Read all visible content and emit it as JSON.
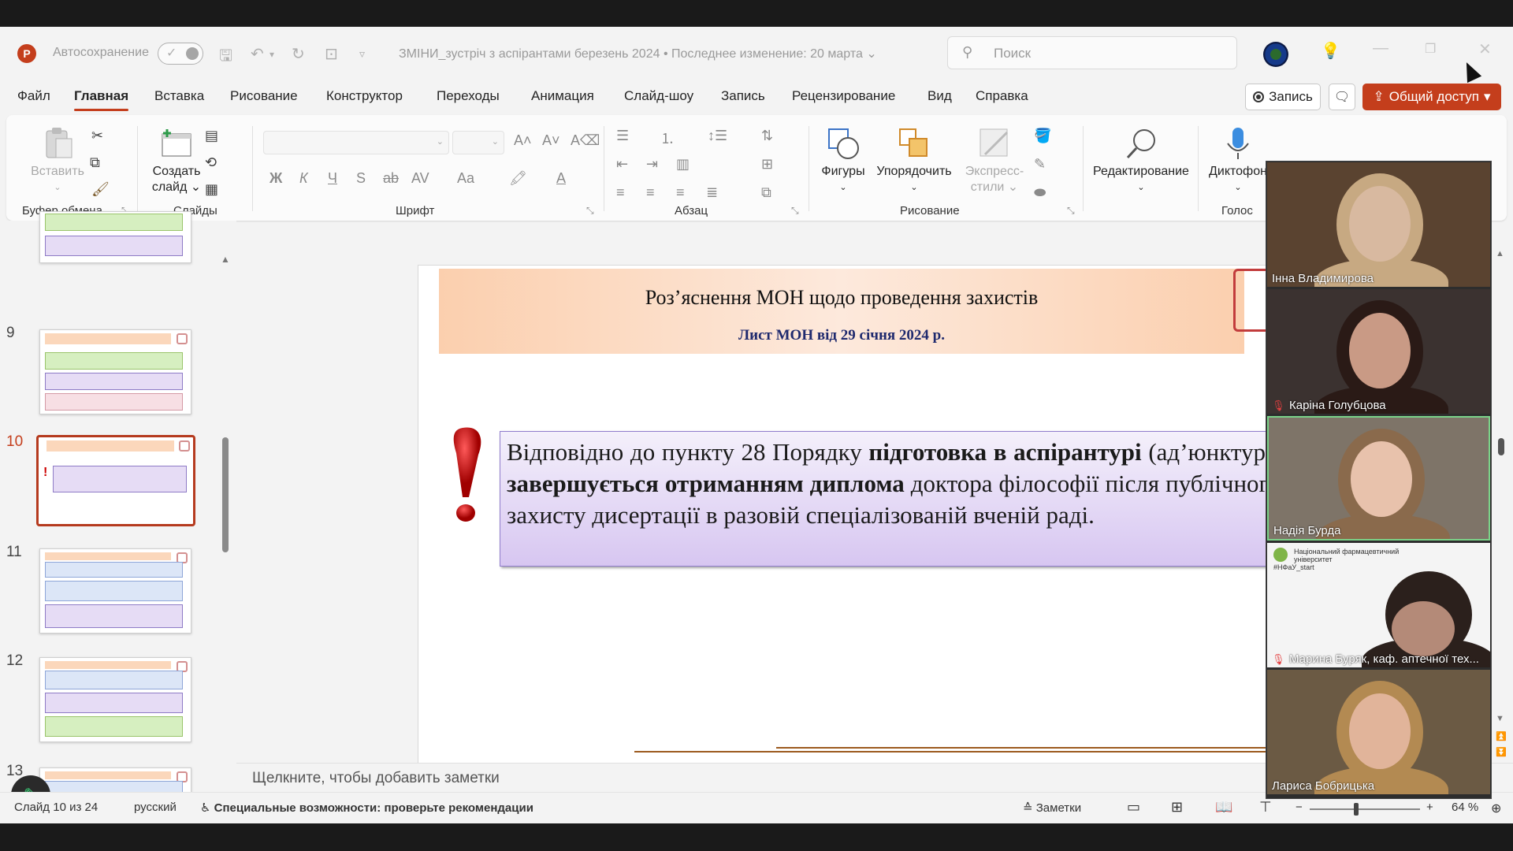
{
  "app": {
    "logo_letter": "P",
    "autosave_label": "Автосохранение",
    "doc_title": "ЗМІНИ_зустріч з аспірантами березень 2024",
    "last_modified": "Последнее изменение: 20 марта",
    "search_placeholder": "Поиск",
    "accent_color": "#c43e1c"
  },
  "menu": {
    "items": [
      "Файл",
      "Главная",
      "Вставка",
      "Рисование",
      "Конструктор",
      "Переходы",
      "Анимация",
      "Слайд-шоу",
      "Запись",
      "Рецензирование",
      "Вид",
      "Справка"
    ],
    "active": "Главная",
    "record_label": "Запись",
    "share_label": "Общий доступ"
  },
  "ribbon": {
    "paste_label": "Вставить",
    "new_slide_label_1": "Создать",
    "new_slide_label_2": "слайд",
    "shapes_label": "Фигуры",
    "arrange_label": "Упорядочить",
    "quick_styles_label_1": "Экспресс-",
    "quick_styles_label_2": "стили",
    "editing_label": "Редактирование",
    "dictate_label": "Диктофон",
    "groups": {
      "clipboard": "Буфер обмена",
      "slides": "Слайды",
      "font": "Шрифт",
      "paragraph": "Абзац",
      "drawing": "Рисование",
      "voice": "Голос"
    },
    "font_buttons": {
      "bold": "Ж",
      "italic": "К",
      "underline": "Ч",
      "shadow": "S",
      "strike": "ab",
      "spacing": "AV",
      "case": "Aa",
      "color": "A"
    }
  },
  "thumbnails": [
    {
      "number": "9"
    },
    {
      "number": "10",
      "active": true
    },
    {
      "number": "11"
    },
    {
      "number": "12"
    },
    {
      "number": "13"
    }
  ],
  "slide": {
    "title": "Роз’яснення МОН щодо проведення захистів",
    "subtitle": "Лист МОН від 29 січня 2024 р.",
    "body_parts": [
      {
        "text": "Відповідно до пункту 28 Порядку ",
        "bold": false
      },
      {
        "text": "підготовка в аспірантурі",
        "bold": true
      },
      {
        "text": " (ад’юнктурі) ",
        "bold": false
      },
      {
        "text": "завершується отриманням диплома",
        "bold": true
      },
      {
        "text": " доктора філософії після публічного захисту дисертації в разовій спеціалізованій вченій раді.",
        "bold": false
      }
    ]
  },
  "notes_placeholder": "Щелкните, чтобы добавить заметки",
  "status": {
    "slide_counter": "Слайд 10 из 24",
    "language": "русский",
    "accessibility": "Специальные возможности: проверьте рекомендации",
    "notes_label": "Заметки",
    "zoom": "64 %",
    "zoom_fraction": 0.42
  },
  "participants": [
    {
      "name": "Інна Владимирова",
      "muted": false,
      "bg": "#5a4330",
      "face": "#d8b9a0",
      "hair": "#c7a982"
    },
    {
      "name": "Каріна Голубцова",
      "muted": true,
      "bg": "#3b3230",
      "face": "#c99a85",
      "hair": "#2a1a16"
    },
    {
      "name": "Надія Бурда",
      "muted": false,
      "bg": "#7e7468",
      "face": "#e8c2ac",
      "hair": "#8a6a4c"
    },
    {
      "name": "Марина Буряк, каф. аптечної тех...",
      "muted": true,
      "bg": "#f4f4f4",
      "face": "#b48a78",
      "hair": "#2b201c"
    },
    {
      "name": "Лариса Бобрицька",
      "muted": false,
      "bg": "#6b5a44",
      "face": "#e1b49a",
      "hair": "#b38a52"
    }
  ],
  "participant_org": [
    "Національний фармацевтичний",
    "університет",
    "#НФаУ_start"
  ]
}
